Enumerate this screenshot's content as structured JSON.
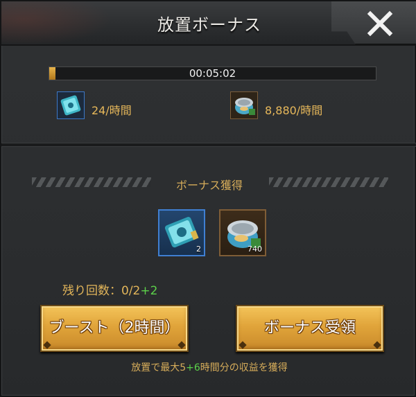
{
  "header": {
    "title": "放置ボーナス",
    "close_icon": "close-icon"
  },
  "timer": {
    "value": "00:05:02",
    "progress_fraction": 0.02
  },
  "rates": [
    {
      "icon": "card-icon",
      "text": "24/時間"
    },
    {
      "icon": "food-can-icon",
      "text": "8,880/時間"
    }
  ],
  "bonus": {
    "title": "ボーナス獲得",
    "items": [
      {
        "icon": "card-icon",
        "count": "2"
      },
      {
        "icon": "food-can-icon",
        "count": "740"
      }
    ]
  },
  "remaining": {
    "label": "残り回数：0/2",
    "bonus": "+2"
  },
  "buttons": {
    "boost": "ブースト（2時間）",
    "claim": "ボーナス受領"
  },
  "footer": {
    "prefix": "放置で最大5",
    "bonus": "+6",
    "suffix": "時間分の収益を獲得"
  },
  "colors": {
    "accent_gold": "#e7b85a",
    "bonus_green": "#5cd14a",
    "frame_blue": "#3c78c8"
  }
}
